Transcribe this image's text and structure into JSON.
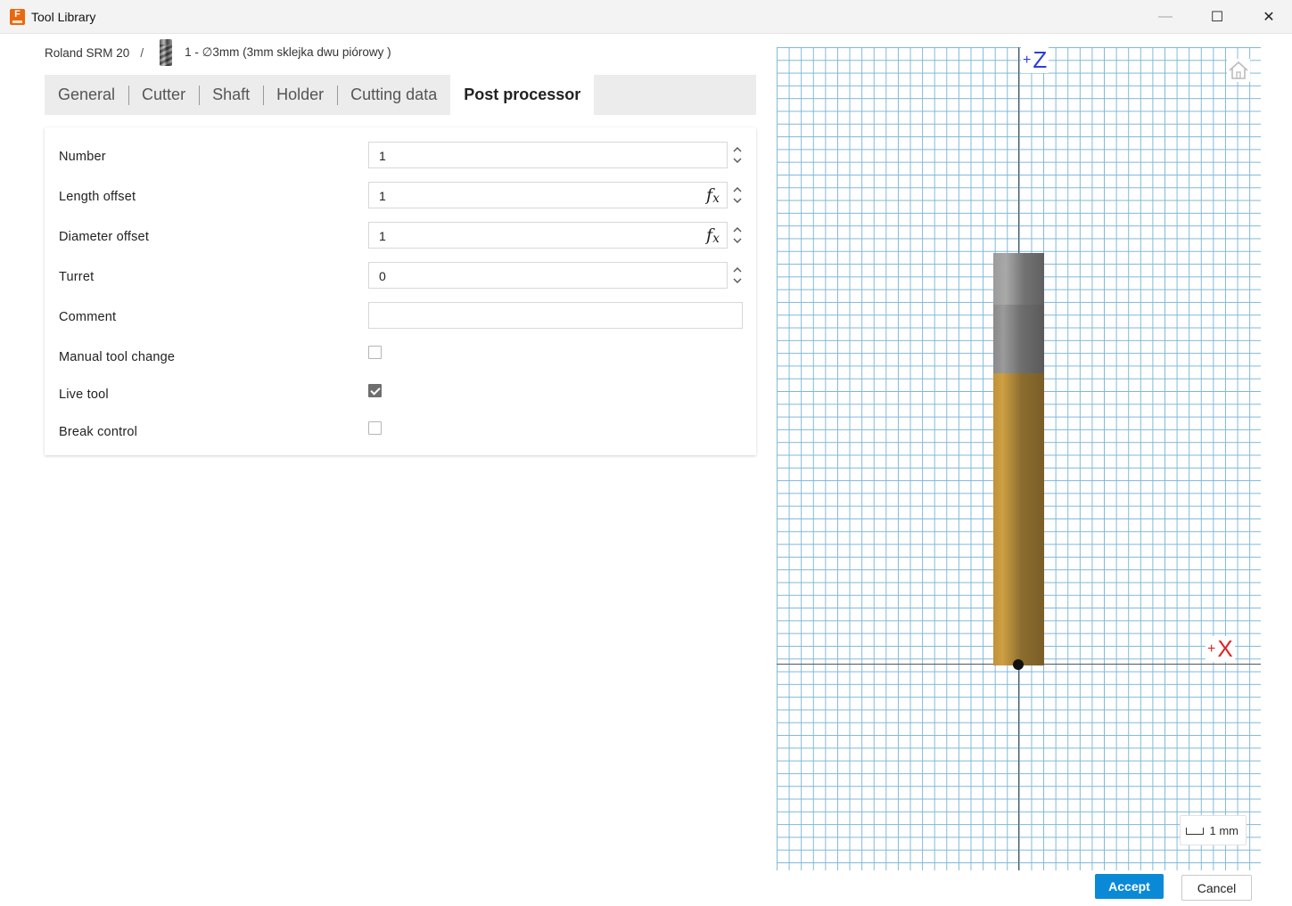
{
  "window": {
    "title": "Tool Library",
    "minimize_glyph": "—",
    "maximize_glyph": "☐",
    "close_glyph": "✕",
    "app_icon_letter": "F"
  },
  "breadcrumb": {
    "library": "Roland SRM 20",
    "separator": "/",
    "tool": "1 - ∅3mm (3mm sklejka dwu piórowy )"
  },
  "tabs": [
    {
      "label": "General"
    },
    {
      "label": "Cutter"
    },
    {
      "label": "Shaft"
    },
    {
      "label": "Holder"
    },
    {
      "label": "Cutting data"
    },
    {
      "label": "Post processor",
      "active": true
    }
  ],
  "form": {
    "number": {
      "label": "Number",
      "value": "1"
    },
    "length_offset": {
      "label": "Length offset",
      "value": "1"
    },
    "diameter_offset": {
      "label": "Diameter offset",
      "value": "1"
    },
    "turret": {
      "label": "Turret",
      "value": "0"
    },
    "comment": {
      "label": "Comment",
      "value": ""
    },
    "manual_tool_change": {
      "label": "Manual tool change",
      "checked": false
    },
    "live_tool": {
      "label": "Live tool",
      "checked": true
    },
    "break_control": {
      "label": "Break control",
      "checked": false
    }
  },
  "preview": {
    "z_axis_label": "Z",
    "x_axis_label": "X",
    "axis_plus": "+",
    "scale_label": "1 mm",
    "colors": {
      "grid": "#7fb8d9",
      "z_axis": "#2b3de0",
      "x_axis": "#e02323",
      "cutter": "#b8903c",
      "holder": "#7a7a7a"
    }
  },
  "buttons": {
    "accept": "Accept",
    "cancel": "Cancel"
  }
}
